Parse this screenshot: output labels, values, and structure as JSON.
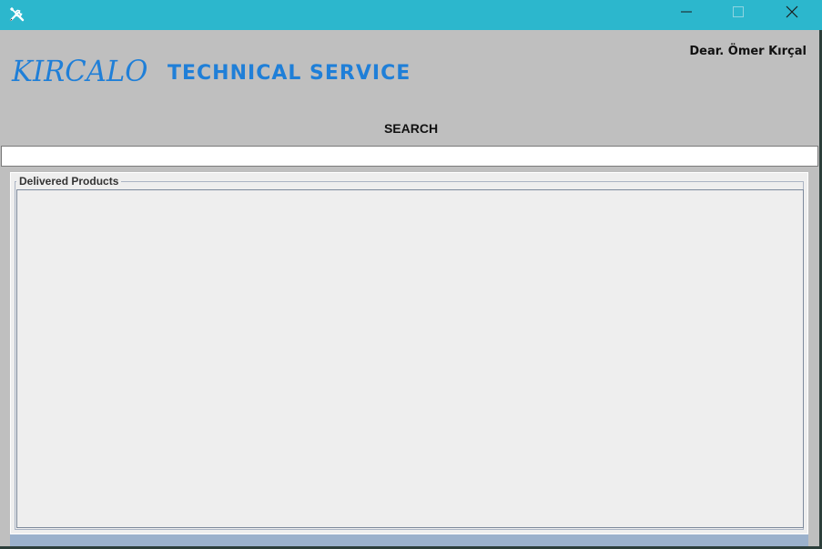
{
  "window": {
    "icon": "tools-icon",
    "controls": {
      "minimize": "minimize-icon",
      "maximize": "maximize-icon",
      "close": "close-icon"
    },
    "titlebar_color": "#2cb7cd"
  },
  "header": {
    "logo_text": "KIRCALO",
    "title": "TECHNICAL SERVICE",
    "greeting": "Dear. Ömer Kırçal",
    "accent_color": "#1f7fd8"
  },
  "search": {
    "label": "SEARCH",
    "value": "",
    "placeholder": ""
  },
  "panel": {
    "title": "Delivered Products",
    "items": []
  }
}
